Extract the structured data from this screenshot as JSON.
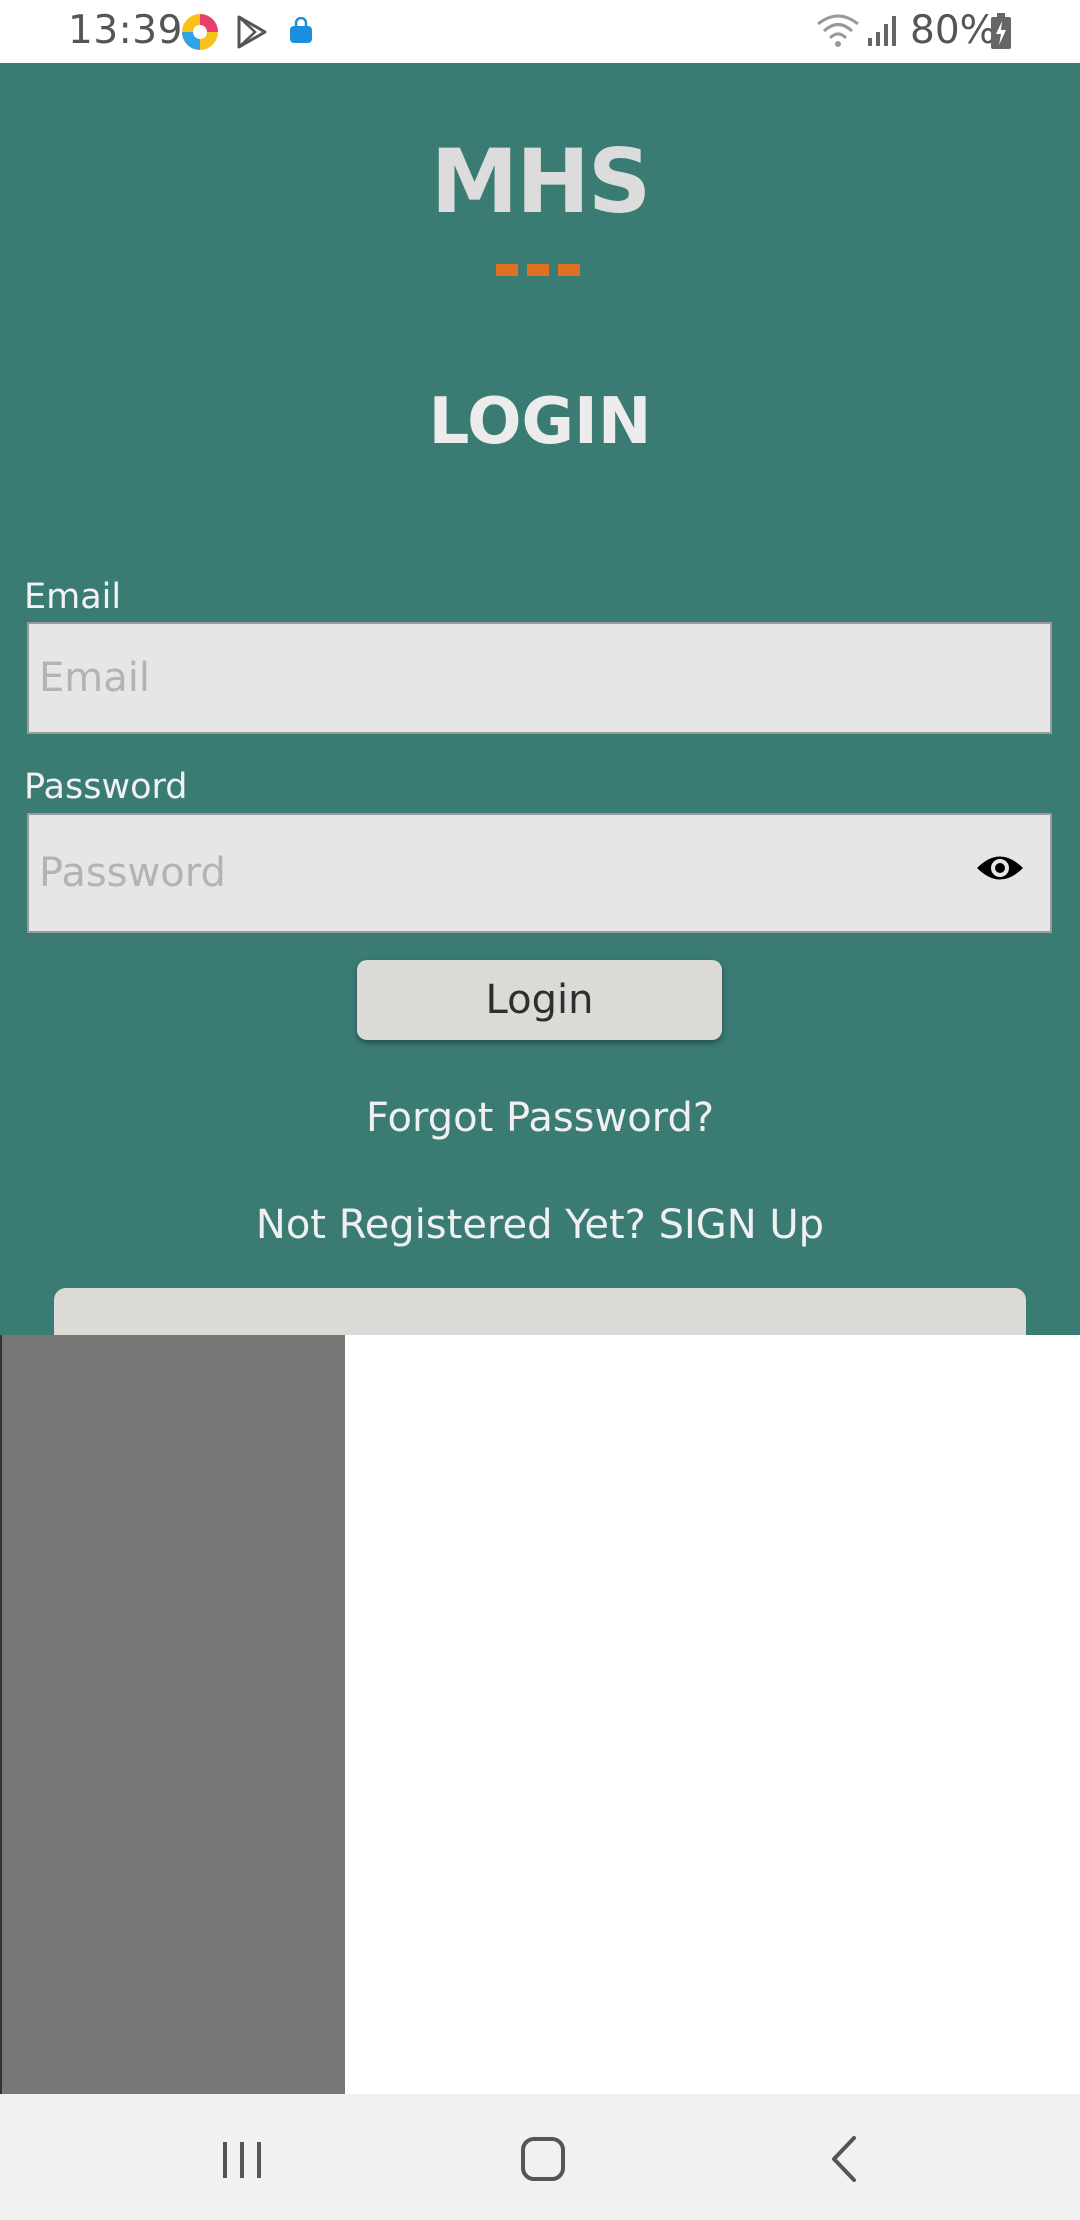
{
  "status_bar": {
    "time": "13:39",
    "icons": [
      "app-colorful-icon",
      "play-store-icon",
      "shopping-bag-icon",
      "wifi-icon",
      "signal-icon",
      "battery-charging-icon"
    ],
    "battery": "80%"
  },
  "login": {
    "logo": "MHS",
    "heading": "LOGIN",
    "email_label": "Email",
    "email_placeholder": "Email",
    "email_value": "",
    "password_label": "Password",
    "password_placeholder": "Password",
    "password_value": "",
    "button_label": "Login",
    "forgot_link": "Forgot Password?",
    "signup_link": "Not Registered Yet? SIGN Up"
  },
  "nav": {
    "buttons": [
      "recents-icon",
      "home-icon",
      "back-icon"
    ]
  },
  "colors": {
    "teal": "#3a7b74",
    "accent_orange": "#e07122",
    "input_bg": "#e6e6e6",
    "button_bg": "#dcdad7"
  }
}
